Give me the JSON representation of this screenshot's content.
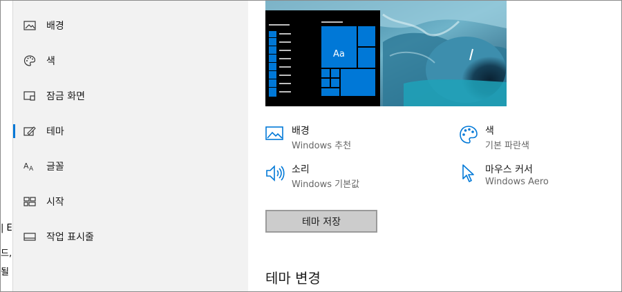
{
  "left_fragments": [
    "| E",
    "드,",
    "될 0"
  ],
  "sidebar": {
    "items": [
      {
        "label": "배경",
        "icon": "image-icon"
      },
      {
        "label": "색",
        "icon": "palette-icon"
      },
      {
        "label": "잠금 화면",
        "icon": "lock-screen-icon"
      },
      {
        "label": "테마",
        "icon": "theme-brush-icon",
        "selected": true
      },
      {
        "label": "글꼴",
        "icon": "font-icon"
      },
      {
        "label": "시작",
        "icon": "start-icon"
      },
      {
        "label": "작업 표시줄",
        "icon": "taskbar-icon"
      }
    ]
  },
  "preview": {
    "tile_text": "Aa"
  },
  "props": [
    {
      "title": "배경",
      "sub": "Windows 추천",
      "icon": "background-image-icon"
    },
    {
      "title": "색",
      "sub": "기본 파란색",
      "icon": "color-palette-icon"
    },
    {
      "title": "소리",
      "sub": "Windows 기본값",
      "icon": "speaker-icon"
    },
    {
      "title": "마우스 커서",
      "sub": "Windows Aero",
      "icon": "mouse-cursor-icon"
    }
  ],
  "save_button": "테마 저장",
  "section_title": "테마 변경",
  "colors": {
    "accent": "#0078d7",
    "sidebar_bg": "#f2f2f2",
    "button_bg": "#cccccc"
  }
}
